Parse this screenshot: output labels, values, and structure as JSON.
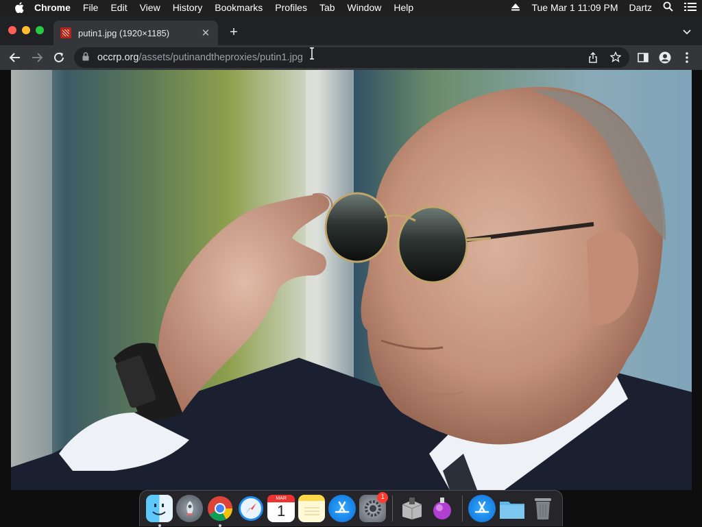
{
  "menubar": {
    "app_name": "Chrome",
    "items": [
      "File",
      "Edit",
      "View",
      "History",
      "Bookmarks",
      "Profiles",
      "Tab",
      "Window",
      "Help"
    ],
    "clock": "Tue Mar 1  11:09 PM",
    "user": "Dartz"
  },
  "tab": {
    "title": "putin1.jpg (1920×1185)",
    "favicon": "occrp-favicon"
  },
  "omnibox": {
    "host": "occrp.org",
    "path": "/assets/putinandtheproxies/putin1.jpg"
  },
  "page": {
    "image_alt": "putin1.jpg"
  },
  "dock": {
    "apps": [
      "Finder",
      "Launchpad",
      "Google Chrome",
      "Safari",
      "Calendar",
      "Notes",
      "App Store",
      "System Preferences",
      "Installer",
      "Creative app",
      "App Store Downloads",
      "Documents Folder",
      "Trash"
    ],
    "calendar_month": "MAR",
    "calendar_day": "1",
    "sys_prefs_badge": "1"
  },
  "colors": {
    "menubar": "#1f1f20",
    "tabstrip": "#202124",
    "toolbar": "#35363a",
    "omnibox": "#202124"
  }
}
